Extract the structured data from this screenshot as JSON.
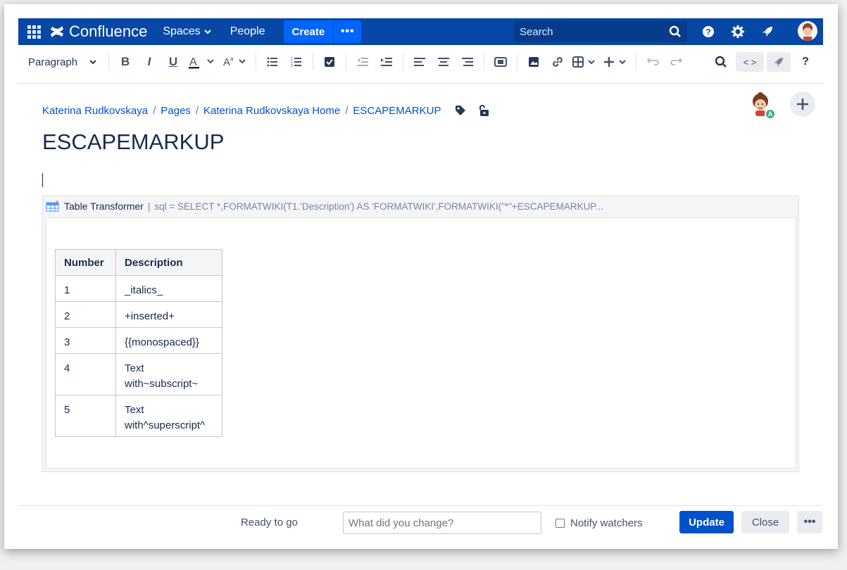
{
  "nav": {
    "logo_text": "Confluence",
    "spaces_label": "Spaces",
    "people_label": "People",
    "create_label": "Create",
    "more_label": "•••",
    "search_placeholder": "Search",
    "colors": {
      "nav_bg": "#0747a6",
      "create_bg": "#0065ff"
    }
  },
  "toolbar": {
    "paragraph_label": "Paragraph",
    "code_label": "< >",
    "help_label": "?"
  },
  "breadcrumb": {
    "items": [
      "Katerina Rudkovskaya",
      "Pages",
      "Katerina Rudkovskaya Home",
      "ESCAPEMARKUP"
    ],
    "separator": "/"
  },
  "page": {
    "title": "ESCAPEMARKUP"
  },
  "collaborator_badge": "A",
  "macro": {
    "name": "Table Transformer",
    "separator": "|",
    "params": "sql = SELECT *,FORMATWIKI(T1.'Description') AS 'FORMATWIKI',FORMATWIKI(\"*\"+ESCAPEMARKUP...",
    "table": {
      "headers": [
        "Number",
        "Description"
      ],
      "rows": [
        [
          "1",
          "_italics_"
        ],
        [
          "2",
          "+inserted+"
        ],
        [
          "3",
          "{{monospaced}}"
        ],
        [
          "4",
          "Text with~subscript~"
        ],
        [
          "5",
          "Text with^superscript^"
        ]
      ]
    }
  },
  "footer": {
    "status": "Ready to go",
    "comment_placeholder": "What did you change?",
    "notify_label": "Notify watchers",
    "update_label": "Update",
    "close_label": "Close",
    "more_label": "•••",
    "colors": {
      "primary": "#0052cc"
    }
  }
}
